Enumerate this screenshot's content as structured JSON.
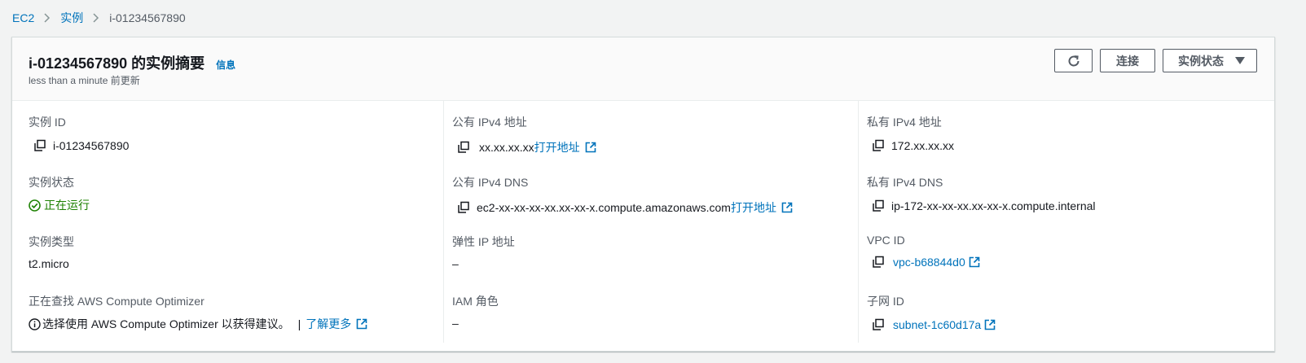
{
  "breadcrumb": {
    "items": [
      "EC2",
      "实例"
    ],
    "current": "i-01234567890"
  },
  "header": {
    "title": "i-01234567890 的实例摘要",
    "info_link": "信息",
    "updated": "less than a minute 前更新",
    "buttons": {
      "refresh_icon": "refresh-icon",
      "connect": "连接",
      "instance_state": "实例状态"
    }
  },
  "col1": {
    "instance_id_label": "实例 ID",
    "instance_id": "i-01234567890",
    "state_label": "实例状态",
    "state": "正在运行",
    "type_label": "实例类型",
    "type": "t2.micro",
    "optimizer_label": "正在查找 AWS Compute Optimizer",
    "optimizer_text": "选择使用 AWS Compute Optimizer 以获得建议。",
    "optimizer_pipe": "|",
    "optimizer_link": "了解更多"
  },
  "col2": {
    "public_ip_label": "公有 IPv4 地址",
    "public_ip": "xx.xx.xx.xx",
    "public_ip_link": "打开地址",
    "public_dns_label": "公有 IPv4 DNS",
    "public_dns": "ec2-xx-xx-xx-xx.xx-xx-x.compute.amazonaws.com",
    "public_dns_link": "打开地址",
    "elastic_ip_label": "弹性 IP 地址",
    "elastic_ip": "–",
    "iam_label": "IAM 角色",
    "iam": "–"
  },
  "col3": {
    "private_ip_label": "私有 IPv4 地址",
    "private_ip": "172.xx.xx.xx",
    "private_dns_label": "私有 IPv4 DNS",
    "private_dns": "ip-172-xx-xx-xx.xx-xx-x.compute.internal",
    "vpc_label": "VPC ID",
    "vpc": "vpc-b68844d0",
    "subnet_label": "子网 ID",
    "subnet": "subnet-1c60d17a"
  },
  "colors": {
    "link": "#0073bb",
    "success": "#1d8102",
    "label": "#545b64"
  }
}
